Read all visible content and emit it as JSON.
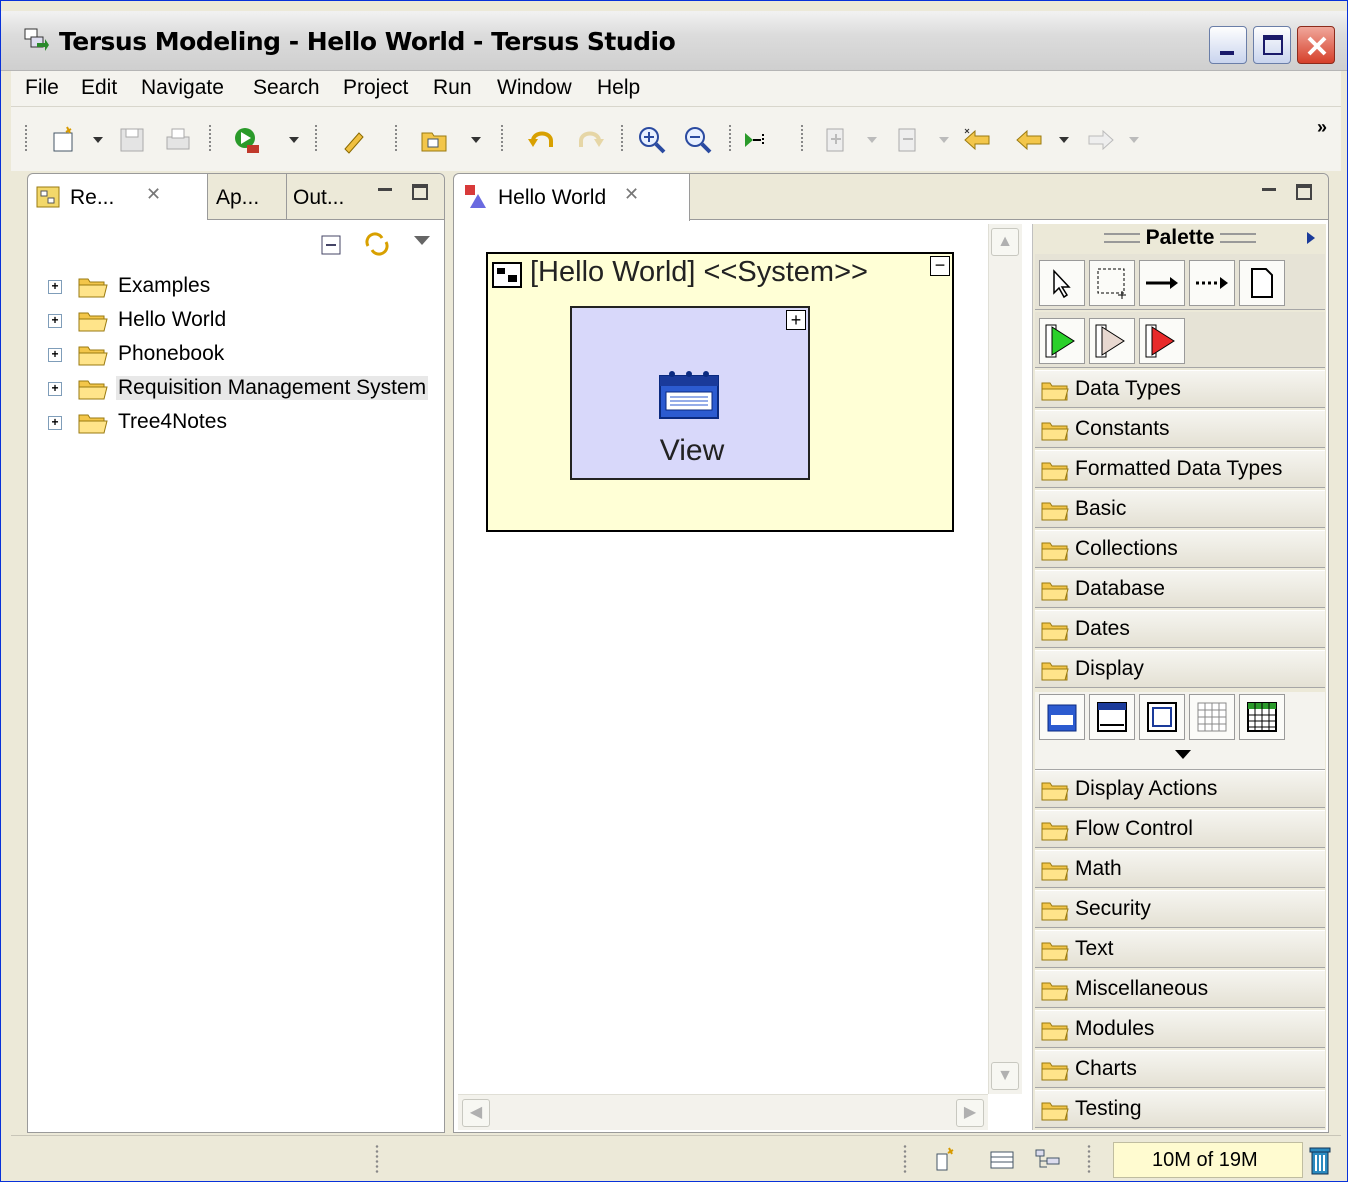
{
  "window": {
    "title": "Tersus Modeling - Hello World - Tersus Studio"
  },
  "menu": [
    "File",
    "Edit",
    "Navigate",
    "Search",
    "Project",
    "Run",
    "Window",
    "Help"
  ],
  "left_view": {
    "tabs": [
      "Re...",
      "Ap...",
      "Out..."
    ],
    "tree": [
      {
        "label": "Examples",
        "selected": false
      },
      {
        "label": "Hello World",
        "selected": false
      },
      {
        "label": "Phonebook",
        "selected": false
      },
      {
        "label": "Requisition Management System",
        "selected": true
      },
      {
        "label": "Tree4Notes",
        "selected": false
      }
    ]
  },
  "editor": {
    "tab": "Hello World",
    "system_title": "[Hello World] <<System>>",
    "view_label": "View"
  },
  "palette": {
    "title": "Palette",
    "drawers": [
      "Data Types",
      "Constants",
      "Formatted Data Types",
      "Basic",
      "Collections",
      "Database",
      "Dates",
      "Display",
      "Display Actions",
      "Flow Control",
      "Math",
      "Security",
      "Text",
      "Miscellaneous",
      "Modules",
      "Charts",
      "Testing"
    ]
  },
  "status": {
    "heap": "10M of 19M"
  },
  "colors": {
    "system_fill": "#ffffd6",
    "view_fill": "#d8d8fa",
    "titlebar_close": "#d6402a"
  }
}
